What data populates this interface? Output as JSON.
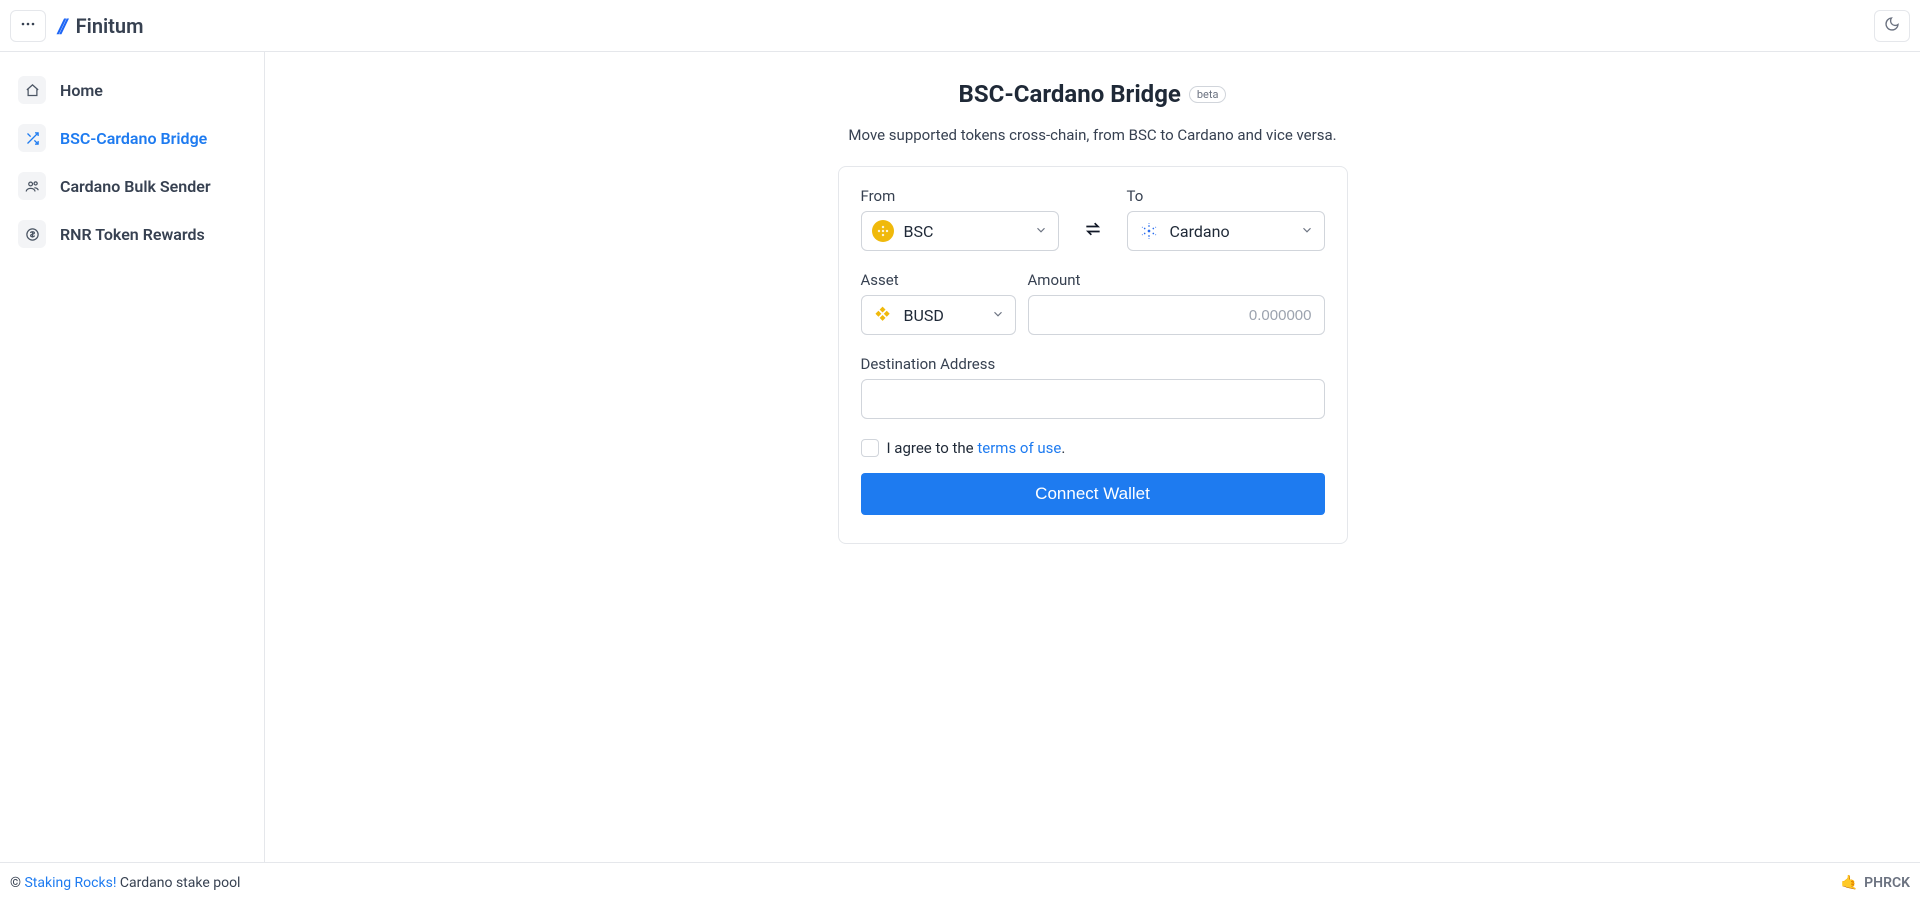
{
  "app": {
    "name": "Finitum"
  },
  "sidebar": {
    "items": [
      {
        "label": "Home"
      },
      {
        "label": "BSC-Cardano Bridge"
      },
      {
        "label": "Cardano Bulk Sender"
      },
      {
        "label": "RNR Token Rewards"
      }
    ],
    "active_index": 1
  },
  "page": {
    "title": "BSC-Cardano Bridge",
    "badge": "beta",
    "subtitle": "Move supported tokens cross-chain, from BSC to Cardano and vice versa."
  },
  "form": {
    "from_label": "From",
    "to_label": "To",
    "from_value": "BSC",
    "to_value": "Cardano",
    "asset_label": "Asset",
    "asset_value": "BUSD",
    "amount_label": "Amount",
    "amount_placeholder": "0.000000",
    "dest_label": "Destination Address",
    "agree_prefix": "I agree to the ",
    "agree_link": "terms of use",
    "agree_suffix": ".",
    "connect_label": "Connect Wallet"
  },
  "footer": {
    "copy_prefix": "© ",
    "link": "Staking Rocks!",
    "copy_suffix": " Cardano stake pool",
    "ticker": "PHRCK"
  }
}
